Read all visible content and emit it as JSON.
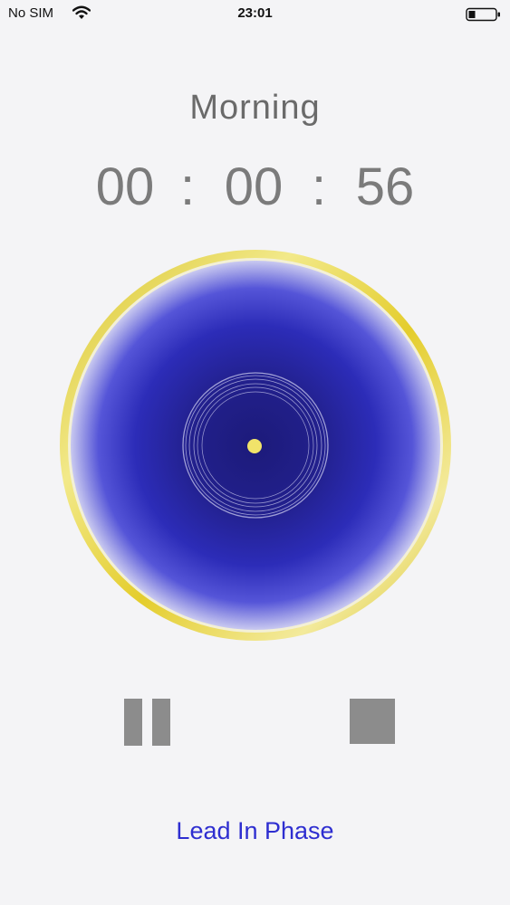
{
  "status_bar": {
    "carrier": "No SIM",
    "time": "23:01",
    "wifi_icon": "wifi-icon",
    "battery_icon": "battery-icon"
  },
  "session": {
    "title": "Morning"
  },
  "timer": {
    "hours": "00",
    "separator_1": ":",
    "minutes": "00",
    "separator_2": ":",
    "seconds": "56"
  },
  "visualizer": {
    "ring_color": "#e6d23a",
    "core_color": "#23208f",
    "center_dot_color": "#f1e36a"
  },
  "controls": {
    "pause_icon": "pause-icon",
    "stop_icon": "stop-icon",
    "control_color": "#8c8c8c"
  },
  "phase": {
    "label": "Lead In Phase",
    "color": "#2e2ed0"
  }
}
